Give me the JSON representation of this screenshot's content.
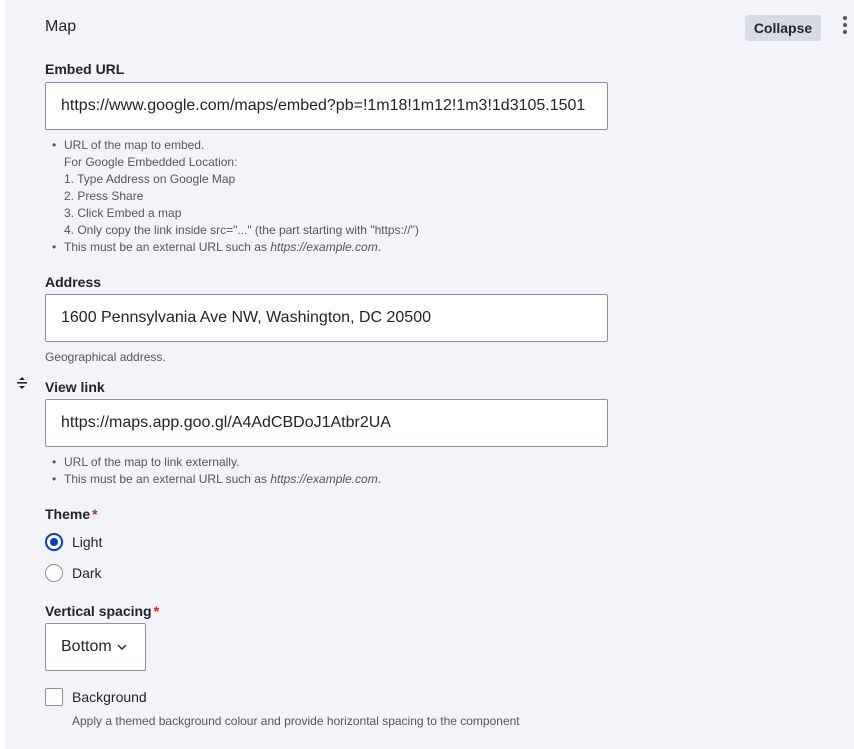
{
  "section": {
    "title": "Map",
    "collapse_label": "Collapse",
    "more_icon": "kebab-vertical-icon"
  },
  "embed_url": {
    "label": "Embed URL",
    "value": "https://www.google.com/maps/embed?pb=!1m18!1m12!1m3!1d3105.1501",
    "help": {
      "item1_line1": "URL of the map to embed.",
      "item1_line2": "For Google Embedded Location:",
      "step1": "1. Type Address on Google Map",
      "step2": "2. Press Share",
      "step3": "3. Click Embed a map",
      "step4": "4. Only copy the link inside src=\"...\" (the part starting with \"https://\")",
      "item2_prefix": "This must be an external URL such as ",
      "item2_example": "https://example.com",
      "item2_suffix": "."
    }
  },
  "address": {
    "label": "Address",
    "value": "1600 Pennsylvania Ave NW, Washington, DC 20500",
    "help": "Geographical address."
  },
  "drag_icon": "drag-handle-icon",
  "view_link": {
    "label": "View link",
    "value": "https://maps.app.goo.gl/A4AdCBDoJ1Atbr2UA",
    "help": {
      "item1": "URL of the map to link externally.",
      "item2_prefix": "This must be an external URL such as ",
      "item2_example": "https://example.com",
      "item2_suffix": "."
    }
  },
  "theme": {
    "label": "Theme",
    "required_mark": "*",
    "options": [
      {
        "label": "Light",
        "checked": true
      },
      {
        "label": "Dark",
        "checked": false
      }
    ]
  },
  "vertical_spacing": {
    "label": "Vertical spacing",
    "required_mark": "*",
    "selected": "Bottom"
  },
  "background": {
    "label": "Background",
    "checked": false,
    "help": "Apply a themed background colour and provide horizontal spacing to the component"
  },
  "colors": {
    "panel_bg": "#f3f4f9",
    "accent": "#003ecc",
    "required": "#d72222",
    "border": "#8e929c"
  }
}
